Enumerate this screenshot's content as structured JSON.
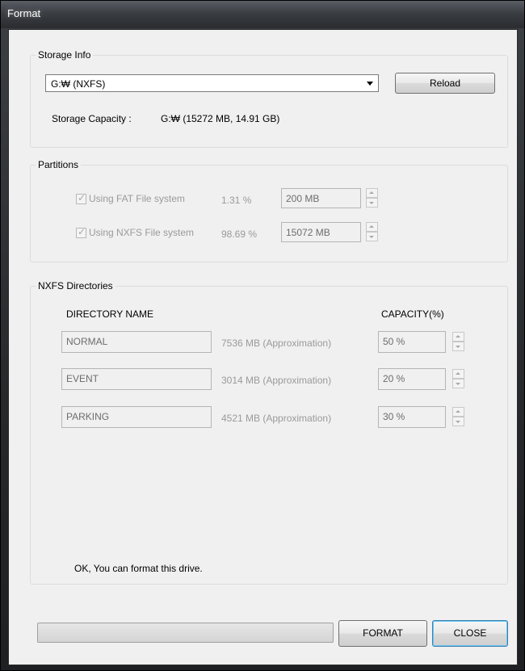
{
  "window": {
    "title": "Format"
  },
  "storage_info": {
    "group_label": "Storage Info",
    "drive_select": "G:₩ (NXFS)",
    "reload_label": "Reload",
    "capacity_label": "Storage Capacity :",
    "capacity_value": "G:₩ (15272 MB, 14.91 GB)"
  },
  "partitions": {
    "group_label": "Partitions",
    "items": [
      {
        "label": "Using FAT File system",
        "percent": "1.31 %",
        "size": "200 MB",
        "checked": true
      },
      {
        "label": "Using NXFS File system",
        "percent": "98.69 %",
        "size": "15072 MB",
        "checked": true
      }
    ]
  },
  "directories": {
    "group_label": "NXFS Directories",
    "col_name": "DIRECTORY NAME",
    "col_capacity": "CAPACITY(%)",
    "rows": [
      {
        "name": "NORMAL",
        "approx": "7536 MB (Approximation)",
        "capacity": "50 %"
      },
      {
        "name": "EVENT",
        "approx": "3014 MB (Approximation)",
        "capacity": "20 %"
      },
      {
        "name": "PARKING",
        "approx": "4521 MB (Approximation)",
        "capacity": "30 %"
      }
    ],
    "status": "OK, You can format this drive."
  },
  "footer": {
    "progress": 0,
    "format_label": "FORMAT",
    "close_label": "CLOSE"
  },
  "colors": {
    "accent": "#3c7fb1",
    "disabled_text": "#9a9a9a",
    "dialog_bg": "#f0f0f0"
  }
}
